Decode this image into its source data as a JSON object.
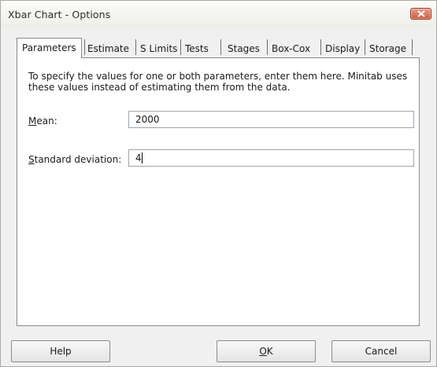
{
  "window": {
    "title": "Xbar Chart - Options"
  },
  "tabs": [
    {
      "label": "Parameters",
      "active": true
    },
    {
      "label": "Estimate"
    },
    {
      "label": "S Limits"
    },
    {
      "label": "Tests"
    },
    {
      "label": "Stages"
    },
    {
      "label": "Box-Cox"
    },
    {
      "label": "Display"
    },
    {
      "label": "Storage"
    }
  ],
  "panel": {
    "description": "To specify the values for one or both parameters, enter them here.  Minitab uses these values instead of estimating them from the data.",
    "mean": {
      "label_mnemonic": "M",
      "label_rest": "ean:",
      "value": "2000"
    },
    "std_dev": {
      "label_mnemonic": "S",
      "label_rest": "tandard deviation:",
      "value": "4"
    }
  },
  "buttons": {
    "help": "Help",
    "ok_mnemonic": "O",
    "ok_rest": "K",
    "cancel": "Cancel"
  },
  "colors": {
    "window_bg": "#f0f0f0",
    "panel_bg": "#ffffff",
    "close_button": "#c85a3c"
  }
}
